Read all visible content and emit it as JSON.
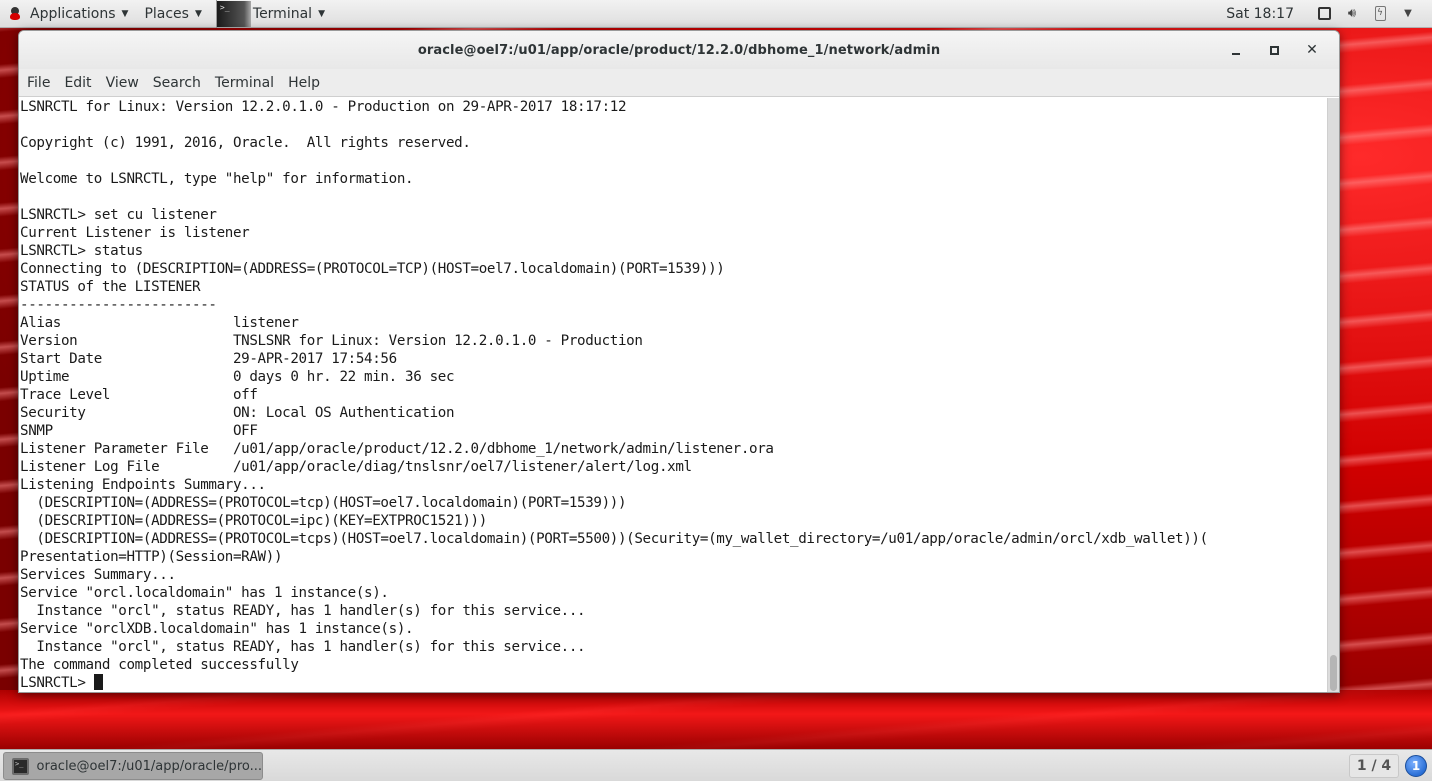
{
  "top_panel": {
    "applications_label": "Applications",
    "places_label": "Places",
    "active_app_label": "Terminal",
    "clock": "Sat 18:17"
  },
  "window": {
    "title": "oracle@oel7:/u01/app/oracle/product/12.2.0/dbhome_1/network/admin",
    "menu": [
      "File",
      "Edit",
      "View",
      "Search",
      "Terminal",
      "Help"
    ]
  },
  "terminal": {
    "lines": [
      "LSNRCTL for Linux: Version 12.2.0.1.0 - Production on 29-APR-2017 18:17:12",
      "",
      "Copyright (c) 1991, 2016, Oracle.  All rights reserved.",
      "",
      "Welcome to LSNRCTL, type \"help\" for information.",
      "",
      "LSNRCTL> set cu listener",
      "Current Listener is listener",
      "LSNRCTL> status",
      "Connecting to (DESCRIPTION=(ADDRESS=(PROTOCOL=TCP)(HOST=oel7.localdomain)(PORT=1539)))",
      "STATUS of the LISTENER",
      "------------------------",
      "Alias                     listener",
      "Version                   TNSLSNR for Linux: Version 12.2.0.1.0 - Production",
      "Start Date                29-APR-2017 17:54:56",
      "Uptime                    0 days 0 hr. 22 min. 36 sec",
      "Trace Level               off",
      "Security                  ON: Local OS Authentication",
      "SNMP                      OFF",
      "Listener Parameter File   /u01/app/oracle/product/12.2.0/dbhome_1/network/admin/listener.ora",
      "Listener Log File         /u01/app/oracle/diag/tnslsnr/oel7/listener/alert/log.xml",
      "Listening Endpoints Summary...",
      "  (DESCRIPTION=(ADDRESS=(PROTOCOL=tcp)(HOST=oel7.localdomain)(PORT=1539)))",
      "  (DESCRIPTION=(ADDRESS=(PROTOCOL=ipc)(KEY=EXTPROC1521)))",
      "  (DESCRIPTION=(ADDRESS=(PROTOCOL=tcps)(HOST=oel7.localdomain)(PORT=5500))(Security=(my_wallet_directory=/u01/app/oracle/admin/orcl/xdb_wallet))(",
      "Presentation=HTTP)(Session=RAW))",
      "Services Summary...",
      "Service \"orcl.localdomain\" has 1 instance(s).",
      "  Instance \"orcl\", status READY, has 1 handler(s) for this service...",
      "Service \"orclXDB.localdomain\" has 1 instance(s).",
      "  Instance \"orcl\", status READY, has 1 handler(s) for this service...",
      "The command completed successfully"
    ],
    "prompt": "LSNRCTL> "
  },
  "taskbar": {
    "task_label": "oracle@oel7:/u01/app/oracle/pro...",
    "workspace": "1 / 4",
    "notification_count": "1"
  }
}
